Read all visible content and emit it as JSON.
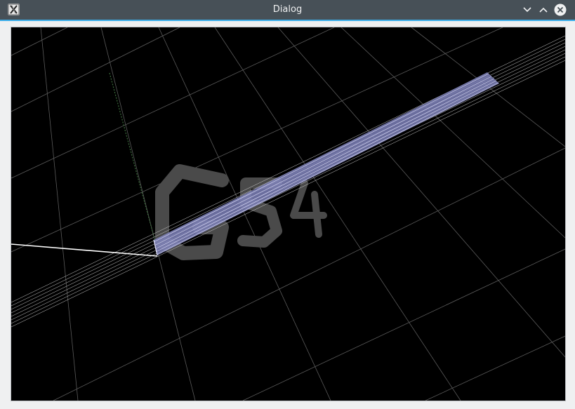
{
  "window": {
    "title": "Dialog",
    "icons": {
      "app": "x-app-icon",
      "minimize": "chevron-down-icon",
      "maximize": "chevron-up-icon",
      "close": "close-circle-icon"
    },
    "accent_color": "#3daee9",
    "titlebar_color": "#475057"
  },
  "viewer": {
    "background_color": "#000000",
    "logo_text": "G54",
    "logo_color": "#4a4a4a",
    "detector_color": "#c8c8ff",
    "track_color": "#ffffff"
  }
}
